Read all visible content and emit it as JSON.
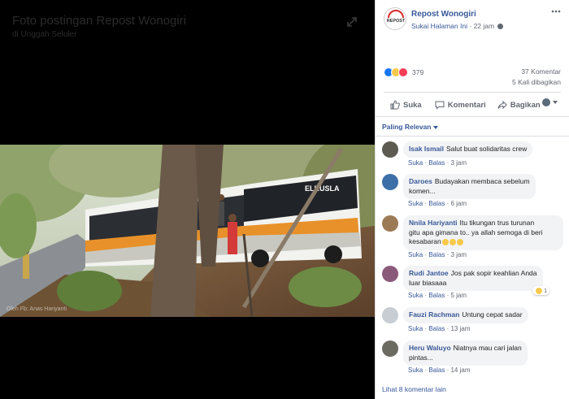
{
  "viewer": {
    "title": "Foto postingan Repost Wonogiri",
    "subtitle": "di Unggah Seluler",
    "photo_credit": "Oleh Fb: Anas Hariyanti"
  },
  "post": {
    "page_name": "Repost Wonogiri",
    "like_page": "Sukai Halaman Ini",
    "separator": "·",
    "time": "22 jam",
    "reaction_count": "379",
    "comments_count": "37 Komentar",
    "shares_count": "5 Kali dibagikan",
    "avatar_text": "REPOST"
  },
  "actions": {
    "like": "Suka",
    "comment": "Komentari",
    "share": "Bagikan"
  },
  "sort_label": "Paling Relevan",
  "comments": [
    {
      "name": "Isak Ismail",
      "lines": [
        "Salut buat solidaritas crew"
      ],
      "like": "Suka",
      "reply": "Balas",
      "time": "3 jam",
      "color": "#5d5a52"
    },
    {
      "name": "Daroes",
      "lines": [
        "Budayakan membaca sebelum",
        "komen..."
      ],
      "like": "Suka",
      "reply": "Balas",
      "time": "6 jam",
      "color": "#3c6ea8"
    },
    {
      "name": "Nnila Hariyanti",
      "lines": [
        "Itu tikungan trus turunan",
        "gitu apa gimana to.. ya allah semoga di beri",
        "kesabaran"
      ],
      "like": "Suka",
      "reply": "Balas",
      "time": "3 jam",
      "color": "#9b7a55"
    },
    {
      "name": "Rudi Jantoe",
      "lines": [
        "Jos pak sopir keahlian Anda",
        "luar biasaaa"
      ],
      "like": "Suka",
      "reply": "Balas",
      "time": "5 jam",
      "color": "#8a5a7a",
      "reaction_count": "1"
    },
    {
      "name": "Fauzi Rachman",
      "lines": [
        "Untung cepat sadar"
      ],
      "like": "Suka",
      "reply": "Balas",
      "time": "13 jam",
      "color": "#c8cdd4"
    },
    {
      "name": "Heru Waluyo",
      "lines": [
        "Niatnya mau cari jalan",
        "pintas..."
      ],
      "like": "Suka",
      "reply": "Balas",
      "time": "14 jam",
      "color": "#6b6b62"
    }
  ],
  "more_comments": "Lihat 8 komentar lain",
  "colors": {
    "link": "#385898",
    "muted": "#606770",
    "bubble": "#f2f3f5",
    "bus_orange": "#e8912a"
  }
}
